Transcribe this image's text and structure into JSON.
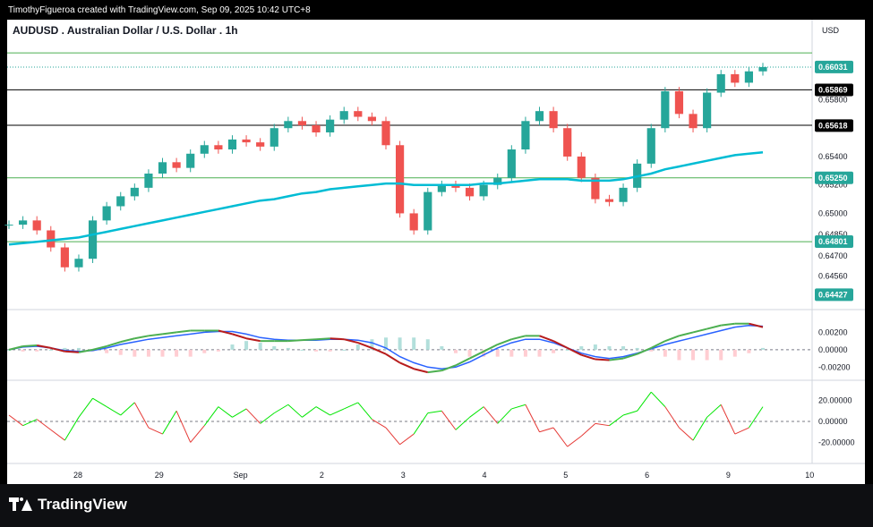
{
  "attribution": "TimothyFigueroa created with TradingView.com, Sep 09, 2025 10:42 UTC+8",
  "brand": {
    "name": "TradingView"
  },
  "colors": {
    "background": "#ffffff",
    "up": "#26a69a",
    "down": "#ef5350",
    "ma": "#00bcd4",
    "green_line": "#4caf50",
    "black_line": "#000000",
    "macd": "#2962ff",
    "signal_up": "#4caf50",
    "signal_down": "#b71c1c",
    "momentum_up": "#00e600",
    "momentum_down": "#e53935"
  },
  "chart_data": [
    {
      "type": "line",
      "title": "AUDUSD . Australian Dollar / U.S. Dollar . 1h",
      "subtitle": "",
      "currency": "USD",
      "xlabel": "",
      "ylabel": "",
      "x_ticks": [
        "28",
        "29",
        "Sep",
        "2",
        "3",
        "4",
        "5",
        "6",
        "9",
        "10"
      ],
      "y_ticks": [
        "0.65800",
        "0.65400",
        "0.65200",
        "0.65000",
        "0.64850",
        "0.64700",
        "0.64560"
      ],
      "ylim": [
        0.6436,
        0.662
      ],
      "price_labels": [
        {
          "value": "0.66031",
          "style": "green"
        },
        {
          "value": "0.65869",
          "style": "black"
        },
        {
          "value": "0.65618",
          "style": "black"
        },
        {
          "value": "0.65250",
          "style": "green"
        },
        {
          "value": "0.64801",
          "style": "green"
        },
        {
          "value": "0.64427",
          "style": "green"
        }
      ],
      "horizontal_lines": [
        {
          "value": 0.6613,
          "color": "green"
        },
        {
          "value": 0.6587,
          "color": "black"
        },
        {
          "value": 0.6562,
          "color": "black"
        },
        {
          "value": 0.6525,
          "color": "green"
        },
        {
          "value": 0.648,
          "color": "green"
        }
      ],
      "series": [
        {
          "role": "close",
          "values": [
            0.6492,
            0.6495,
            0.6488,
            0.6476,
            0.6462,
            0.6468,
            0.6495,
            0.6505,
            0.6512,
            0.6518,
            0.6528,
            0.6536,
            0.6532,
            0.6542,
            0.6548,
            0.6545,
            0.6552,
            0.655,
            0.6547,
            0.656,
            0.6565,
            0.6562,
            0.6557,
            0.6566,
            0.6572,
            0.6568,
            0.6565,
            0.6548,
            0.65,
            0.6488,
            0.6515,
            0.652,
            0.6518,
            0.6512,
            0.652,
            0.6525,
            0.6545,
            0.6565,
            0.6572,
            0.656,
            0.654,
            0.6525,
            0.651,
            0.6508,
            0.6518,
            0.6535,
            0.656,
            0.6586,
            0.657,
            0.656,
            0.6585,
            0.6598,
            0.6592,
            0.66,
            0.6603
          ]
        },
        {
          "role": "moving_average",
          "values": [
            0.6478,
            0.6479,
            0.648,
            0.6481,
            0.6482,
            0.6483,
            0.6485,
            0.6487,
            0.6489,
            0.6491,
            0.6493,
            0.6495,
            0.6497,
            0.6499,
            0.6501,
            0.6503,
            0.6505,
            0.6507,
            0.6509,
            0.651,
            0.6512,
            0.6514,
            0.6515,
            0.6517,
            0.6518,
            0.6519,
            0.652,
            0.6521,
            0.6521,
            0.652,
            0.652,
            0.652,
            0.652,
            0.652,
            0.6521,
            0.6521,
            0.6522,
            0.6523,
            0.6524,
            0.6524,
            0.6524,
            0.6523,
            0.6523,
            0.6523,
            0.6524,
            0.6526,
            0.6528,
            0.6531,
            0.6533,
            0.6535,
            0.6537,
            0.6539,
            0.6541,
            0.6542,
            0.6543
          ]
        }
      ]
    },
    {
      "type": "line",
      "y_ticks": [
        "0.00200",
        "0.00000",
        "-0.00200"
      ],
      "ylim": [
        -0.003,
        0.004
      ],
      "series": [
        {
          "role": "macd",
          "values": [
            0.0,
            0.0003,
            0.0004,
            0.0002,
            -0.0001,
            -0.0002,
            -0.0001,
            0.0002,
            0.0006,
            0.0009,
            0.0012,
            0.0014,
            0.0016,
            0.0018,
            0.002,
            0.0021,
            0.0021,
            0.0018,
            0.0014,
            0.0012,
            0.0011,
            0.0011,
            0.0011,
            0.0012,
            0.0012,
            0.0011,
            0.0008,
            0.0002,
            -0.0008,
            -0.0015,
            -0.002,
            -0.0022,
            -0.002,
            -0.0014,
            -0.0006,
            0.0002,
            0.0008,
            0.0012,
            0.0012,
            0.0008,
            0.0002,
            -0.0004,
            -0.0008,
            -0.001,
            -0.0008,
            -0.0004,
            0.0001,
            0.0006,
            0.001,
            0.0014,
            0.0018,
            0.0022,
            0.0026,
            0.0028,
            0.0027
          ]
        },
        {
          "role": "signal",
          "values": [
            0.0,
            0.0004,
            0.0005,
            0.0002,
            -0.0002,
            -0.0003,
            0.0,
            0.0004,
            0.0009,
            0.0013,
            0.0016,
            0.0018,
            0.002,
            0.0022,
            0.0022,
            0.0022,
            0.0018,
            0.0013,
            0.001,
            0.001,
            0.001,
            0.0011,
            0.0012,
            0.0013,
            0.0012,
            0.0008,
            0.0002,
            -0.0005,
            -0.0015,
            -0.0022,
            -0.0026,
            -0.0024,
            -0.0018,
            -0.001,
            -0.0002,
            0.0006,
            0.0012,
            0.0016,
            0.0016,
            0.001,
            0.0002,
            -0.0006,
            -0.0011,
            -0.0012,
            -0.001,
            -0.0005,
            0.0002,
            0.001,
            0.0016,
            0.002,
            0.0024,
            0.0028,
            0.003,
            0.003,
            0.0026
          ]
        }
      ]
    },
    {
      "type": "line",
      "y_ticks": [
        "20.00000",
        "0.00000",
        "-20.00000"
      ],
      "ylim": [
        -35,
        35
      ],
      "series": [
        {
          "role": "momentum",
          "values": [
            6,
            -4,
            2,
            -8,
            -18,
            4,
            22,
            14,
            6,
            18,
            -6,
            -12,
            10,
            -20,
            -4,
            14,
            4,
            12,
            -2,
            8,
            16,
            4,
            14,
            6,
            12,
            18,
            2,
            -6,
            -22,
            -12,
            8,
            10,
            -8,
            4,
            14,
            -2,
            12,
            16,
            -10,
            -6,
            -24,
            -14,
            -2,
            -4,
            6,
            10,
            28,
            14,
            -6,
            -18,
            4,
            16,
            -12,
            -6,
            14
          ]
        }
      ]
    }
  ]
}
